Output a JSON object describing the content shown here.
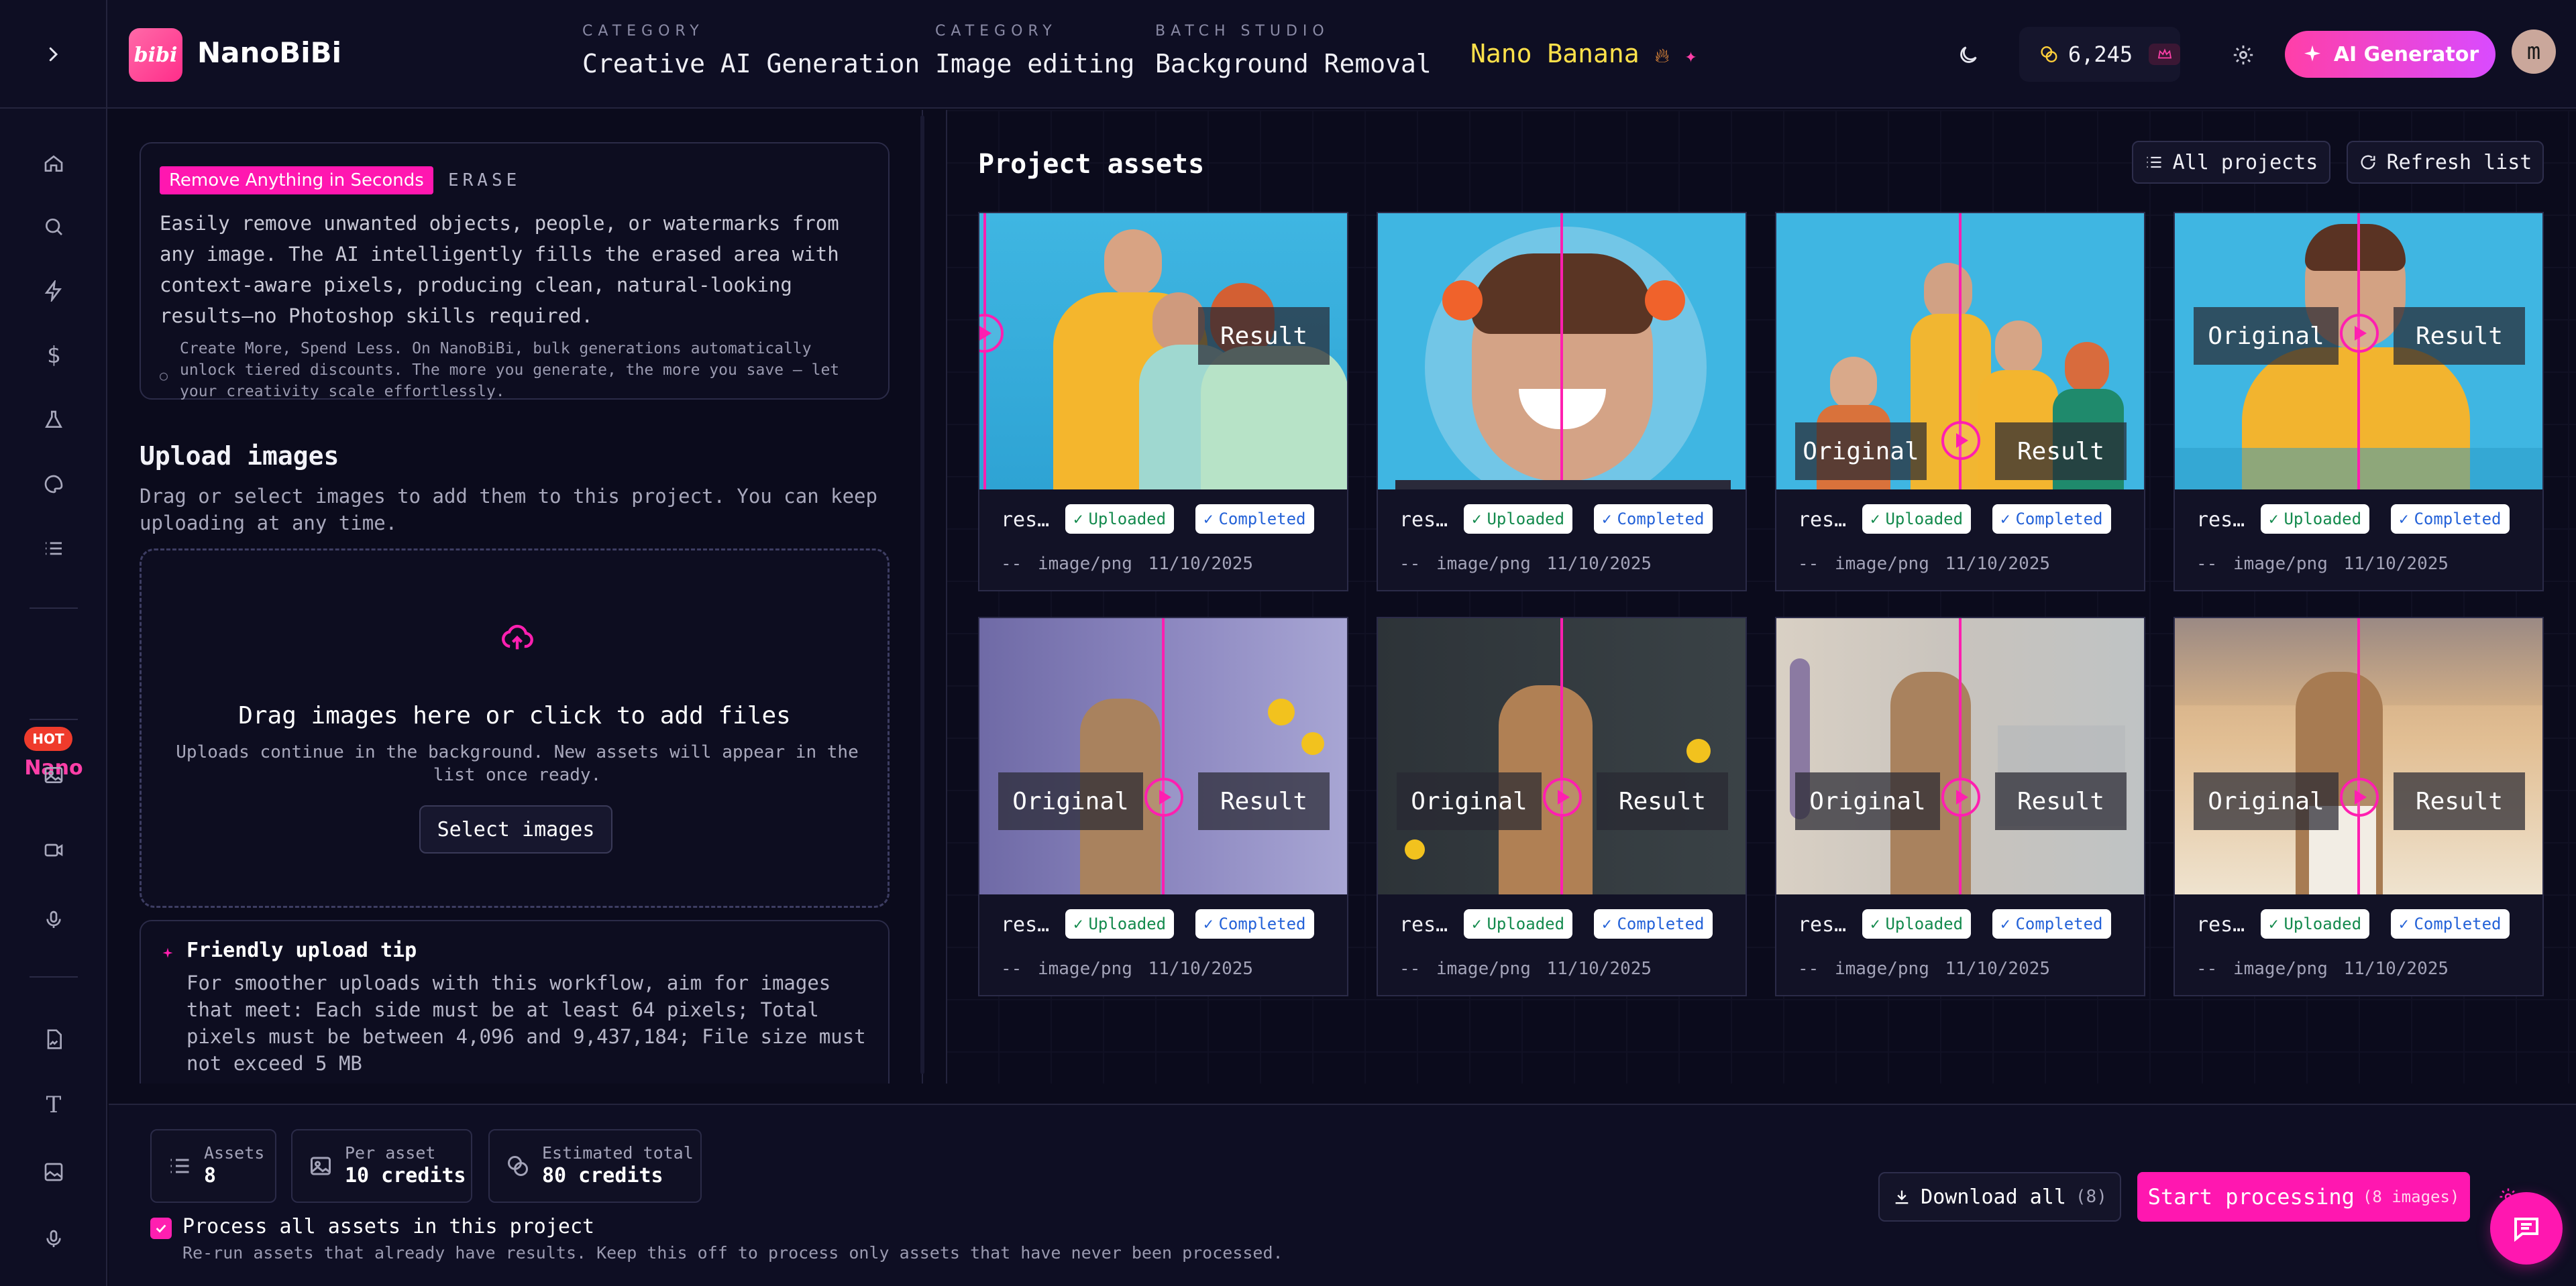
{
  "header": {
    "brand": "NanoBiBi",
    "logo_text": "bibi",
    "nav": [
      {
        "caption": "CATEGORY",
        "value": "Creative AI Generation"
      },
      {
        "caption": "CATEGORY",
        "value": "Image editing"
      },
      {
        "caption": "BATCH STUDIO",
        "value": "Background Removal"
      }
    ],
    "promo": "Nano Banana",
    "credits": "6,245",
    "ai_generator": "AI Generator",
    "avatar_initial": "m"
  },
  "rail": {
    "hot_badge": "HOT",
    "nano_label": "Nano",
    "icons": [
      "home-icon",
      "search-icon",
      "bolt-icon",
      "dollar-icon",
      "flask-icon",
      "palette-icon",
      "list-icon",
      "image-icon",
      "video-icon",
      "mic-icon",
      "image-file-icon",
      "text-icon",
      "image-frame-icon",
      "mic-alt-icon"
    ]
  },
  "info": {
    "badge": "Remove Anything in Seconds",
    "tag": "ERASE",
    "description": "Easily remove unwanted objects, people, or watermarks from any image. The AI intelligently fills the erased area with context-aware pixels, producing clean, natural-looking results—no Photoshop skills required.",
    "note": "Create More, Spend Less. On NanoBiBi, bulk generations automatically unlock tiered discounts. The more you generate, the more you save — let your creativity scale effortlessly."
  },
  "upload": {
    "heading": "Upload images",
    "description": "Drag or select images to add them to this project. You can keep uploading at any time.",
    "drop_title": "Drag images here or click to add files",
    "drop_sub": "Uploads continue in the background. New assets will appear in the list once ready.",
    "select_button": "Select images"
  },
  "tip": {
    "title": "Friendly upload tip",
    "body": "For smoother uploads with this workflow, aim for images that meet: Each side must be at least 64 pixels; Total pixels must be between 4,096 and 9,437,184; File size must not exceed 5 MB"
  },
  "assets": {
    "title": "Project assets",
    "all_projects": "All projects",
    "refresh": "Refresh list",
    "status_uploaded": "Uploaded",
    "status_completed": "Completed",
    "label_original": "Original",
    "label_result": "Result",
    "items": [
      {
        "name": "res…",
        "size": "--",
        "type": "image/png",
        "date": "11/10/2025"
      },
      {
        "name": "res…",
        "size": "--",
        "type": "image/png",
        "date": "11/10/2025"
      },
      {
        "name": "res…",
        "size": "--",
        "type": "image/png",
        "date": "11/10/2025"
      },
      {
        "name": "res…",
        "size": "--",
        "type": "image/png",
        "date": "11/10/2025"
      },
      {
        "name": "res…",
        "size": "--",
        "type": "image/png",
        "date": "11/10/2025"
      },
      {
        "name": "res…",
        "size": "--",
        "type": "image/png",
        "date": "11/10/2025"
      },
      {
        "name": "res…",
        "size": "--",
        "type": "image/png",
        "date": "11/10/2025"
      },
      {
        "name": "res…",
        "size": "--",
        "type": "image/png",
        "date": "11/10/2025"
      }
    ]
  },
  "footer": {
    "assets_caption": "Assets",
    "assets_value": "8",
    "per_asset_caption": "Per asset",
    "per_asset_value": "10 credits",
    "estimated_caption": "Estimated total",
    "estimated_value": "80 credits",
    "process_all_label": "Process all assets in this project",
    "process_all_hint": "Re-run assets that already have results. Keep this off to process only assets that have never been processed.",
    "download_all": "Download all",
    "download_count": "(8)",
    "start_processing": "Start processing",
    "start_count": "(8 images)"
  },
  "colors": {
    "accent": "#ff17b0",
    "promo": "#ffe14a",
    "background": "#0b0b1c"
  }
}
